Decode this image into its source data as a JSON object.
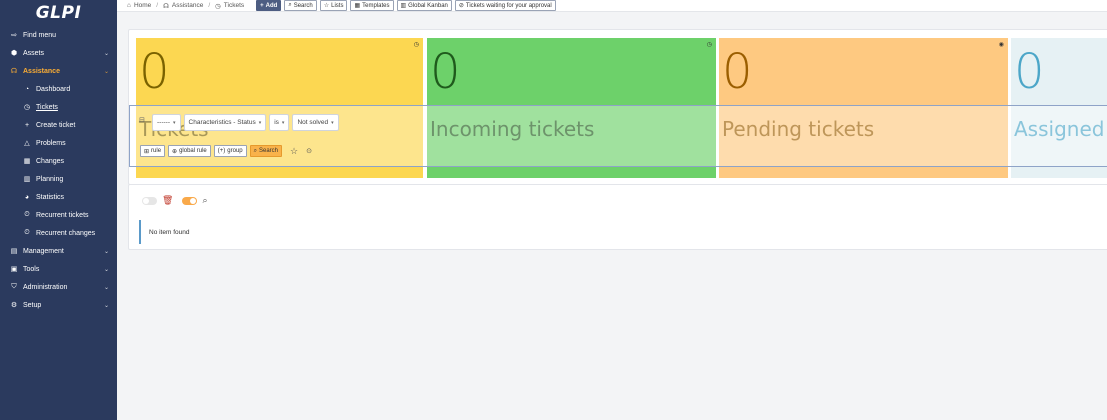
{
  "app": {
    "logo": "GLPI"
  },
  "sidebar": {
    "find_menu": "Find menu",
    "items": [
      {
        "label": "Assets",
        "icon": "box-icon",
        "glyph": "⬢",
        "chevron": "⌄"
      },
      {
        "label": "Assistance",
        "icon": "headset-icon",
        "glyph": "☊",
        "chevron": "⌄"
      },
      {
        "label": "Management",
        "icon": "wallet-icon",
        "glyph": "▤",
        "chevron": "⌄"
      },
      {
        "label": "Tools",
        "icon": "briefcase-icon",
        "glyph": "▣",
        "chevron": "⌄"
      },
      {
        "label": "Administration",
        "icon": "shield-icon",
        "glyph": "⛉",
        "chevron": "⌄"
      },
      {
        "label": "Setup",
        "icon": "gear-icon",
        "glyph": "⚙",
        "chevron": "⌄"
      }
    ],
    "sub_items": [
      {
        "label": "Dashboard",
        "icon": "dashboard-icon",
        "glyph": "◔"
      },
      {
        "label": "Tickets",
        "icon": "ticket-icon",
        "glyph": "◷"
      },
      {
        "label": "Create ticket",
        "icon": "plus-icon",
        "glyph": "+"
      },
      {
        "label": "Problems",
        "icon": "warning-icon",
        "glyph": "△"
      },
      {
        "label": "Changes",
        "icon": "clipboard-icon",
        "glyph": "▦"
      },
      {
        "label": "Planning",
        "icon": "calendar-icon",
        "glyph": "▥"
      },
      {
        "label": "Statistics",
        "icon": "chart-pie-icon",
        "glyph": "◕"
      },
      {
        "label": "Recurrent tickets",
        "icon": "alarm-icon",
        "glyph": "⏲"
      },
      {
        "label": "Recurrent changes",
        "icon": "alarm-icon",
        "glyph": "⏲"
      }
    ]
  },
  "topbar": {
    "breadcrumb": [
      "Home",
      "Assistance",
      "Tickets"
    ],
    "breadcrumb_sep": "/",
    "buttons": {
      "add": "Add",
      "search": "Search",
      "lists": "Lists",
      "templates": "Templates",
      "kanban": "Global Kanban",
      "approval": "Tickets waiting for your approval"
    }
  },
  "tiles": [
    {
      "count": "0",
      "title": "Tickets",
      "color": "#fcd751"
    },
    {
      "count": "0",
      "title": "Incoming tickets",
      "color": "#6dd16a"
    },
    {
      "count": "0",
      "title": "Pending tickets",
      "color": "#fec981"
    },
    {
      "count": "0",
      "title": "Assigned",
      "color": "#e6f1f4"
    }
  ],
  "criteria": {
    "link": "------",
    "field": "Characteristics - Status",
    "operator": "is",
    "value": "Not solved"
  },
  "search_actions": {
    "rule": "rule",
    "global_rule": "global rule",
    "group": "group",
    "search": "Search"
  },
  "results": {
    "empty_message": "No item found"
  },
  "colors": {
    "sidebar_bg": "#2b3a5e",
    "accent": "#fbad34",
    "primary_btn": "#4d5d82"
  }
}
